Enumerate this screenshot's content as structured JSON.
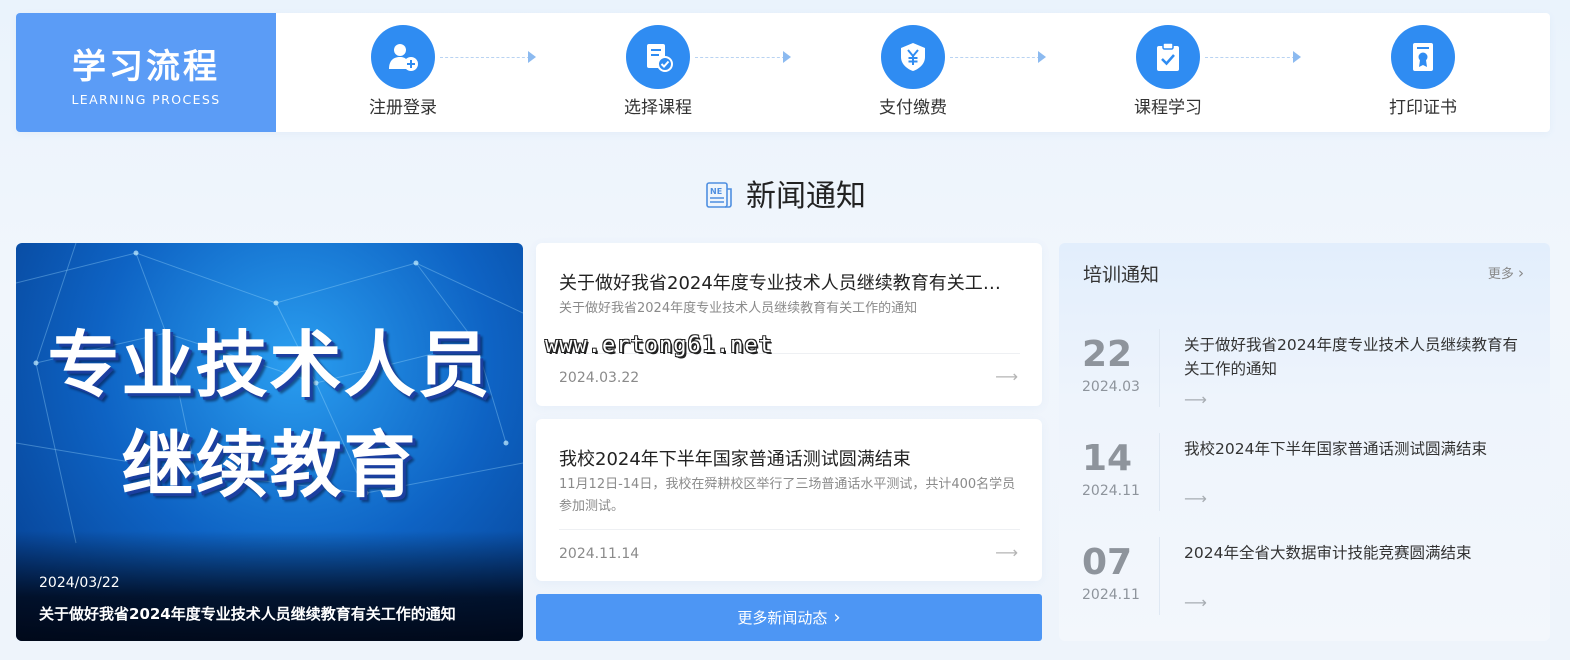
{
  "process": {
    "title": "学习流程",
    "subtitle": "LEARNING PROCESS",
    "steps": [
      {
        "label": "注册登录",
        "icon": "user-add-icon"
      },
      {
        "label": "选择课程",
        "icon": "course-select-icon"
      },
      {
        "label": "支付缴费",
        "icon": "payment-shield-icon"
      },
      {
        "label": "课程学习",
        "icon": "clipboard-check-icon"
      },
      {
        "label": "打印证书",
        "icon": "certificate-icon"
      }
    ]
  },
  "section": {
    "title": "新闻通知",
    "icon": "news-icon"
  },
  "feature": {
    "banner_line1": "专业技术人员",
    "banner_line2": "继续教育",
    "date": "2024/03/22",
    "title": "关于做好我省2024年度专业技术人员继续教育有关工作的通知"
  },
  "news": [
    {
      "title": "关于做好我省2024年度专业技术人员继续教育有关工作的通知",
      "summary": "关于做好我省2024年度专业技术人员继续教育有关工作的通知",
      "date": "2024.03.22",
      "arrow": "⟶"
    },
    {
      "title": "我校2024年下半年国家普通话测试圆满结束",
      "summary": "11月12日-14日，我校在舜耕校区举行了三场普通话水平测试，共计400名学员参加测试。",
      "date": "2024.11.14",
      "arrow": "⟶"
    }
  ],
  "more_news": {
    "label": "更多新闻动态",
    "chevron": "›"
  },
  "training": {
    "title": "培训通知",
    "more": "更多",
    "more_chevron": "›",
    "items": [
      {
        "day": "22",
        "ym": "2024.03",
        "title": "关于做好我省2024年度专业技术人员继续教育有关工作的通知",
        "arrow": "⟶"
      },
      {
        "day": "14",
        "ym": "2024.11",
        "title": "我校2024年下半年国家普通话测试圆满结束",
        "arrow": "⟶"
      },
      {
        "day": "07",
        "ym": "2024.11",
        "title": "2024年全省大数据审计技能竞赛圆满结束",
        "arrow": "⟶"
      }
    ]
  },
  "watermark": "www.ertong61.net",
  "colors": {
    "accent": "#2f8cf2",
    "header_block": "#5b9cf6",
    "button": "#4d96f4"
  }
}
